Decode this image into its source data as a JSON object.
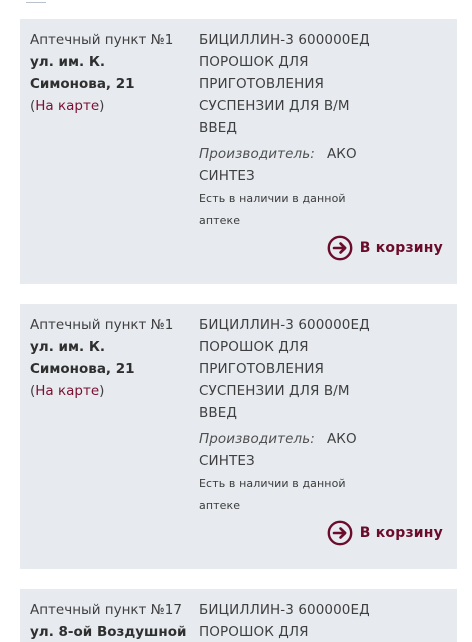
{
  "listings": [
    {
      "point": "Аптечный пункт №1",
      "address": "ул. им. К. Симонова, 21",
      "map_link": "На карте",
      "product": "БИЦИЛЛИН-3 600000ЕД ПОРОШОК ДЛЯ ПРИГОТОВЛЕНИЯ СУСПЕНЗИИ ДЛЯ В/М ВВЕД",
      "manufacturer_label": "Производитель:",
      "manufacturer": "АКО СИНТЕЗ",
      "stock": "Есть в наличии в данной аптеке",
      "cart_label": "В корзину"
    },
    {
      "point": "Аптечный пункт №1",
      "address": "ул. им. К. Симонова, 21",
      "map_link": "На карте",
      "product": "БИЦИЛЛИН-3 600000ЕД ПОРОШОК ДЛЯ ПРИГОТОВЛЕНИЯ СУСПЕНЗИИ ДЛЯ В/М ВВЕД",
      "manufacturer_label": "Производитель:",
      "manufacturer": "АКО СИНТЕЗ",
      "stock": "Есть в наличии в данной аптеке",
      "cart_label": "В корзину"
    },
    {
      "point": "Аптечный пункт №17",
      "address": "ул. 8-ой Воздушной",
      "product": "БИЦИЛЛИН-3 600000ЕД ПОРОШОК ДЛЯ"
    }
  ],
  "icons": {
    "cart": "arrow-right-circle-icon"
  },
  "colors": {
    "card_bg": "#e7ebf0",
    "accent": "#6a0c2a",
    "link": "#7a1030"
  }
}
